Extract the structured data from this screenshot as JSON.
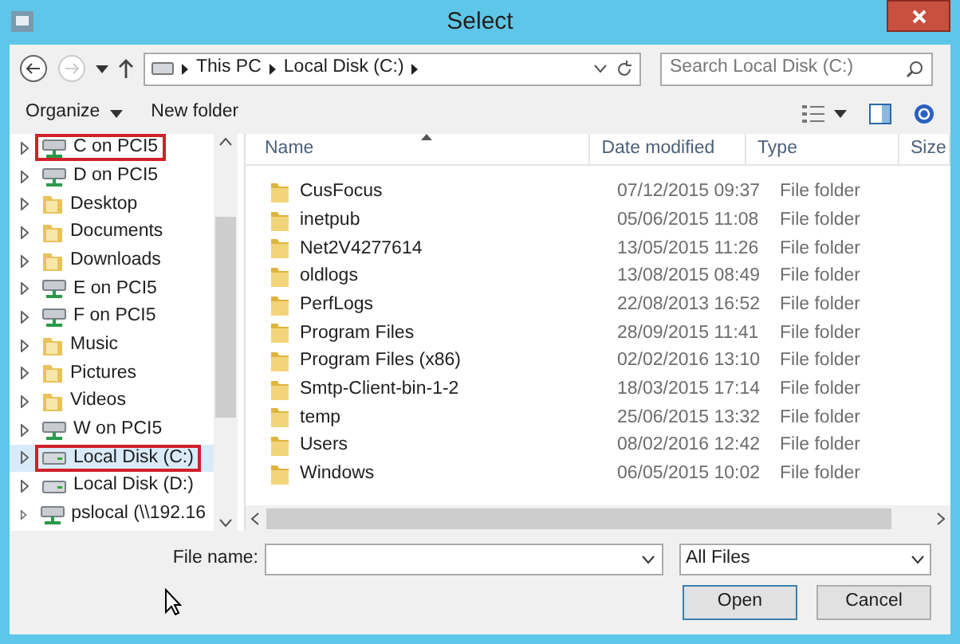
{
  "window": {
    "title": "Select"
  },
  "address": {
    "crumbs": [
      "This PC",
      "Local Disk (C:)"
    ]
  },
  "search": {
    "placeholder": "Search Local Disk (C:)"
  },
  "toolbar": {
    "organize": "Organize",
    "new_folder": "New folder"
  },
  "nav": [
    {
      "label": "C on PCI5",
      "kind": "network",
      "selected": false,
      "highlighted": true
    },
    {
      "label": "D on PCI5",
      "kind": "network",
      "selected": false,
      "highlighted": false
    },
    {
      "label": "Desktop",
      "kind": "folder",
      "selected": false,
      "highlighted": false
    },
    {
      "label": "Documents",
      "kind": "folder",
      "selected": false,
      "highlighted": false
    },
    {
      "label": "Downloads",
      "kind": "folder",
      "selected": false,
      "highlighted": false
    },
    {
      "label": "E on PCI5",
      "kind": "network",
      "selected": false,
      "highlighted": false
    },
    {
      "label": "F on PCI5",
      "kind": "network",
      "selected": false,
      "highlighted": false
    },
    {
      "label": "Music",
      "kind": "folder",
      "selected": false,
      "highlighted": false
    },
    {
      "label": "Pictures",
      "kind": "folder",
      "selected": false,
      "highlighted": false
    },
    {
      "label": "Videos",
      "kind": "folder",
      "selected": false,
      "highlighted": false
    },
    {
      "label": "W on PCI5",
      "kind": "network",
      "selected": false,
      "highlighted": false
    },
    {
      "label": "Local Disk (C:)",
      "kind": "drive",
      "selected": true,
      "highlighted": true
    },
    {
      "label": "Local Disk (D:)",
      "kind": "drive",
      "selected": false,
      "highlighted": false
    },
    {
      "label": "pslocal (\\\\192.16",
      "kind": "network",
      "selected": false,
      "highlighted": false
    }
  ],
  "table": {
    "columns": [
      "Name",
      "Date modified",
      "Type",
      "Size"
    ],
    "rows": [
      [
        "CusFocus",
        "07/12/2015 09:37",
        "File folder"
      ],
      [
        "inetpub",
        "05/06/2015 11:08",
        "File folder"
      ],
      [
        "Net2V4277614",
        "13/05/2015 11:26",
        "File folder"
      ],
      [
        "oldlogs",
        "13/08/2015 08:49",
        "File folder"
      ],
      [
        "PerfLogs",
        "22/08/2013 16:52",
        "File folder"
      ],
      [
        "Program Files",
        "28/09/2015 11:41",
        "File folder"
      ],
      [
        "Program Files (x86)",
        "02/02/2016 13:10",
        "File folder"
      ],
      [
        "Smtp-Client-bin-1-2",
        "18/03/2015 17:14",
        "File folder"
      ],
      [
        "temp",
        "25/06/2015 13:32",
        "File folder"
      ],
      [
        "Users",
        "08/02/2016 12:42",
        "File folder"
      ],
      [
        "Windows",
        "06/05/2015 10:02",
        "File folder"
      ]
    ]
  },
  "file_name": {
    "label": "File name:"
  },
  "file_type": {
    "value": "All Files"
  },
  "buttons": [
    "Open",
    "Cancel"
  ]
}
